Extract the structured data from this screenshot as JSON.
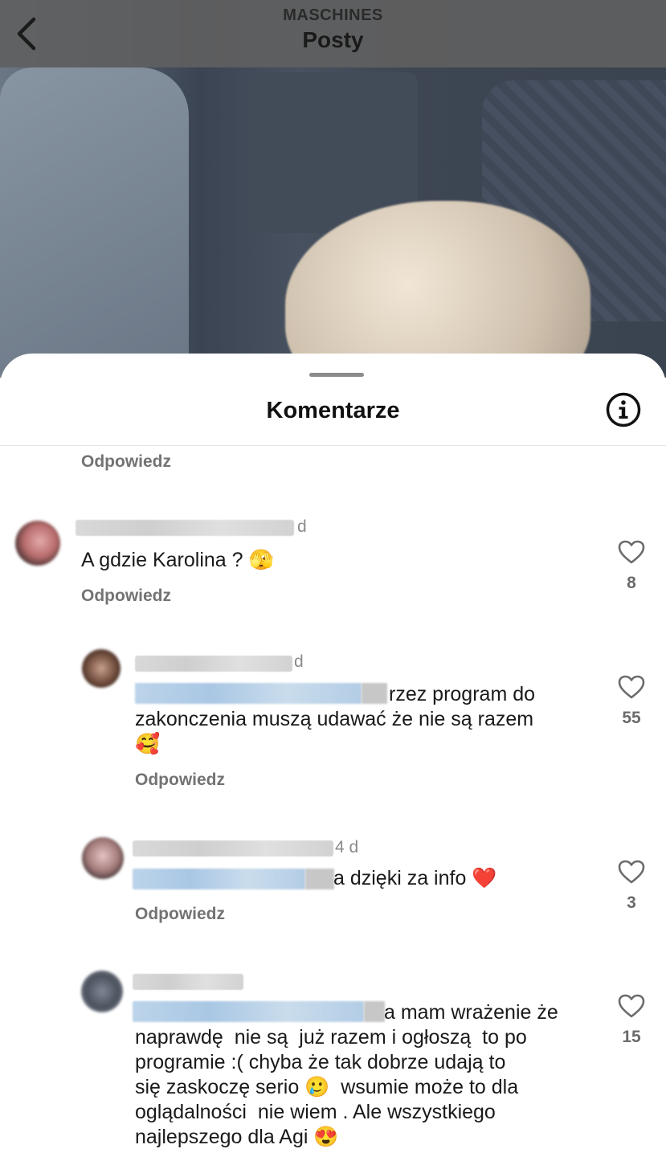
{
  "header": {
    "account": "MASCHINES",
    "title": "Posty"
  },
  "sheet": {
    "title": "Komentarze"
  },
  "reply_label": "Odpowiedz",
  "comments": [
    {
      "age": "d",
      "text": "A gdzie Karolina ? 🫣",
      "likes": "8"
    },
    {
      "age": "d",
      "text": "rzez program do\nzakonczenia muszą udawać że nie są razem\n🥰",
      "likes": "55"
    },
    {
      "age": "4 d",
      "text": "a dzięki za info ❤️",
      "likes": "3"
    },
    {
      "age": "",
      "text": "a mam wrażenie że\nnaprawdę  nie są  już razem i ogłoszą  to po\nprogramie :( chyba że tak dobrze udają to\nsię zaskoczę serio 🥲  wsumie może to dla\noglądalności  nie wiem . Ale wszystkiego\nnajlepszego dla Agi 😍",
      "likes": "15"
    }
  ],
  "icons": {
    "back": "chevron-left-icon",
    "info": "info-circle-icon",
    "like": "heart-outline-icon"
  }
}
